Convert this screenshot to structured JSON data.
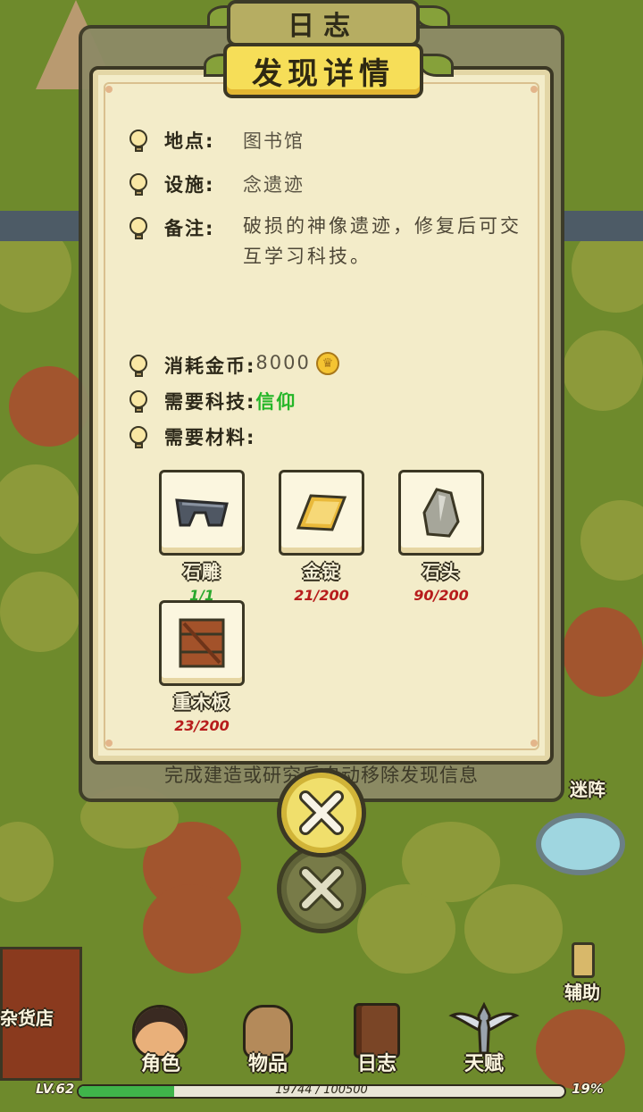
{
  "journal": {
    "title": "日志",
    "footer": "完成建造或研究后自动移除发现信息"
  },
  "detail": {
    "title": "发现详情",
    "location_label": "地点:",
    "location_value": "图书馆",
    "facility_label": "设施:",
    "facility_value": "念遗迹",
    "note_label": "备注:",
    "note_value": "破损的神像遗迹，修复后可交互学习科技。",
    "cost_label": "消耗金币:",
    "cost_value": "8000",
    "tech_label": "需要科技:",
    "tech_value": "信仰",
    "materials_label": "需要材料:",
    "materials": [
      {
        "name": "石雕",
        "count": "1/1",
        "status": "ok"
      },
      {
        "name": "金锭",
        "count": "21/200",
        "status": "insufficient"
      },
      {
        "name": "石头",
        "count": "90/200",
        "status": "insufficient"
      },
      {
        "name": "重木板",
        "count": "23/200",
        "status": "insufficient"
      }
    ]
  },
  "scene": {
    "portal_label": "迷阵",
    "assist_label": "辅助",
    "shop_label": "杂货店"
  },
  "bottom_nav": [
    {
      "label": "角色",
      "icon": "character-icon"
    },
    {
      "label": "物品",
      "icon": "bag-icon"
    },
    {
      "label": "日志",
      "icon": "journal-icon"
    },
    {
      "label": "天赋",
      "icon": "talent-icon"
    }
  ],
  "player": {
    "level": "LV.62",
    "xp_text": "19744 / 100500",
    "xp_percent": "19%",
    "xp_fraction": 0.196
  }
}
